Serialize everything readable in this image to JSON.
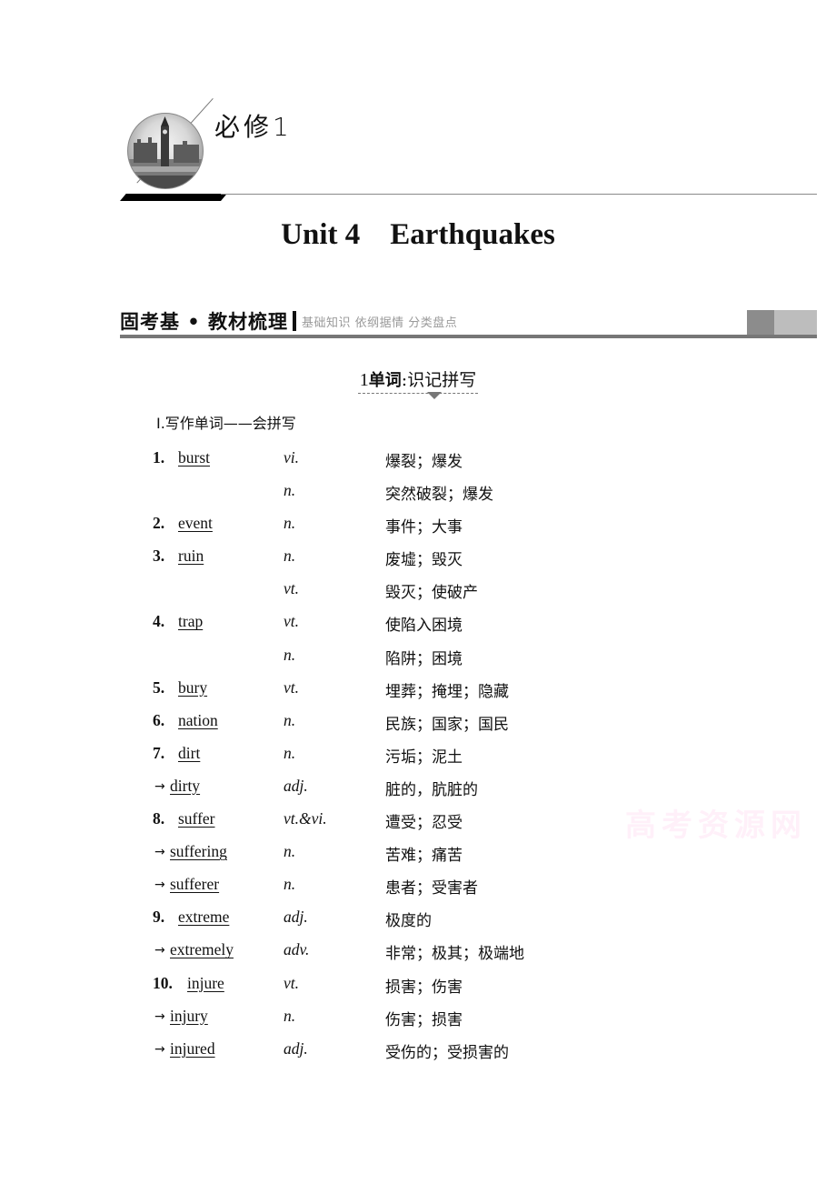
{
  "banner": {
    "title": "必修1",
    "image_icon": "big-ben-photo"
  },
  "unit": {
    "number": "Unit 4",
    "name": "Earthquakes"
  },
  "section": {
    "main": "固考基 • 教材梳理",
    "subtitle": "基础知识  依纲据情  分类盘点"
  },
  "subheading": {
    "num": "1",
    "bold": "单词",
    "rest": ":识记拼写"
  },
  "part": {
    "label": "Ⅰ.写作单词——会拼写"
  },
  "vocab": [
    {
      "num": "1.",
      "derived": false,
      "word": "burst",
      "pos": "vi.",
      "meaning": "爆裂；爆发"
    },
    {
      "num": "",
      "derived": false,
      "word": "",
      "pos": "n.",
      "meaning": "突然破裂；爆发"
    },
    {
      "num": "2.",
      "derived": false,
      "word": "event",
      "pos": "n.",
      "meaning": "事件；大事"
    },
    {
      "num": "3.",
      "derived": false,
      "word": "ruin",
      "pos": "n.",
      "meaning": "废墟；毁灭"
    },
    {
      "num": "",
      "derived": false,
      "word": "",
      "pos": "vt.",
      "meaning": "毁灭；使破产"
    },
    {
      "num": "4.",
      "derived": false,
      "word": "trap",
      "pos": "vt.",
      "meaning": "使陷入困境"
    },
    {
      "num": "",
      "derived": false,
      "word": "",
      "pos": "n.",
      "meaning": "陷阱；困境"
    },
    {
      "num": "5.",
      "derived": false,
      "word": "bury",
      "pos": "vt.",
      "meaning": "埋葬；掩埋；隐藏"
    },
    {
      "num": "6.",
      "derived": false,
      "word": "nation",
      "pos": "n.",
      "meaning": "民族；国家；国民"
    },
    {
      "num": "7.",
      "derived": false,
      "word": "dirt",
      "pos": "n.",
      "meaning": "污垢；泥土"
    },
    {
      "num": "",
      "derived": true,
      "word": "dirty",
      "pos": "adj.",
      "meaning": "脏的，肮脏的"
    },
    {
      "num": "8.",
      "derived": false,
      "word": "suffer",
      "pos": "vt.&vi.",
      "meaning": "遭受；忍受"
    },
    {
      "num": "",
      "derived": true,
      "word": "suffering",
      "pos": "n.",
      "meaning": "苦难；痛苦"
    },
    {
      "num": "",
      "derived": true,
      "word": "sufferer",
      "pos": "n.",
      "meaning": "患者；受害者"
    },
    {
      "num": "9.",
      "derived": false,
      "word": "extreme",
      "pos": "adj.",
      "meaning": "极度的"
    },
    {
      "num": "",
      "derived": true,
      "word": "extremely",
      "pos": "adv.",
      "meaning": "非常；极其；极端地"
    },
    {
      "num": "10.",
      "derived": false,
      "word": "injure",
      "pos": "vt.",
      "meaning": "损害；伤害"
    },
    {
      "num": "",
      "derived": true,
      "word": "injury",
      "pos": "n.",
      "meaning": "伤害；损害"
    },
    {
      "num": "",
      "derived": true,
      "word": "injured",
      "pos": "adj.",
      "meaning": "受伤的；受损害的"
    }
  ],
  "arrow_glyph": "→",
  "watermark": "高考资源网"
}
